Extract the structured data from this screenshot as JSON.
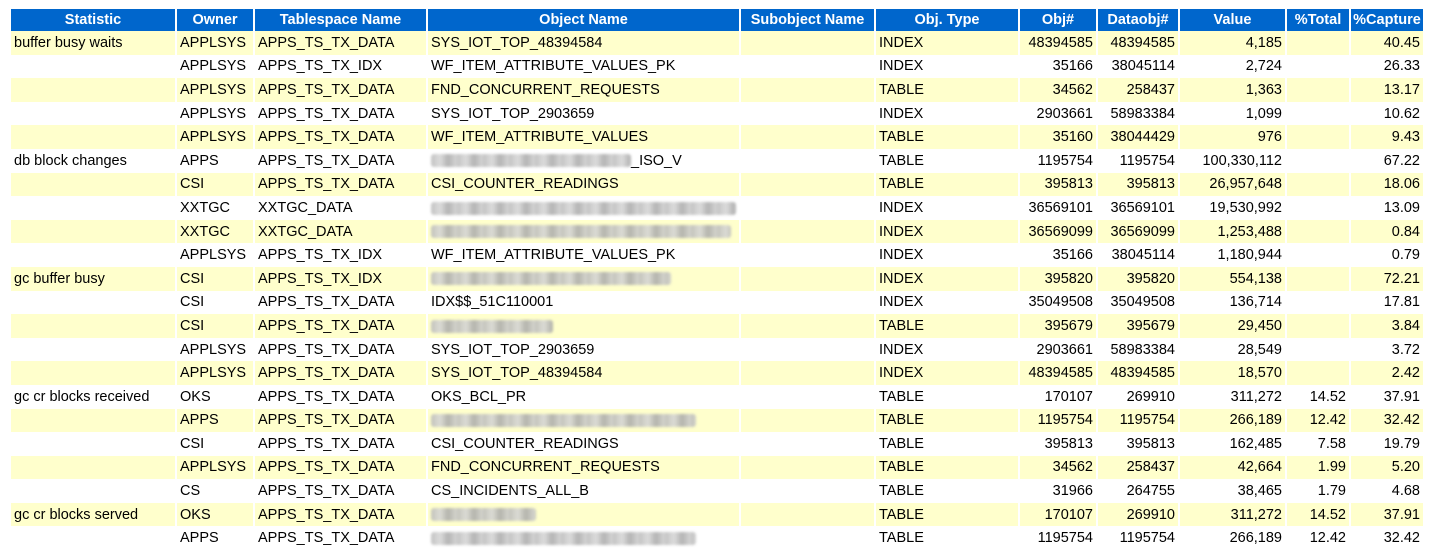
{
  "columns": [
    "Statistic",
    "Owner",
    "Tablespace Name",
    "Object Name",
    "Subobject Name",
    "Obj. Type",
    "Obj#",
    "Dataobj#",
    "Value",
    "%Total",
    "%Capture"
  ],
  "rows": [
    {
      "statistic": "buffer busy waits",
      "owner": "APPLSYS",
      "tablespace": "APPS_TS_TX_DATA",
      "object_name": "SYS_IOT_TOP_48394584",
      "object_redacted": false,
      "subobject": "",
      "obj_type": "INDEX",
      "obj_num": "48394585",
      "dataobj_num": "48394585",
      "value": "4,185",
      "pct_total": "",
      "pct_capture": "40.45"
    },
    {
      "statistic": "",
      "owner": "APPLSYS",
      "tablespace": "APPS_TS_TX_IDX",
      "object_name": "WF_ITEM_ATTRIBUTE_VALUES_PK",
      "object_redacted": false,
      "subobject": "",
      "obj_type": "INDEX",
      "obj_num": "35166",
      "dataobj_num": "38045114",
      "value": "2,724",
      "pct_total": "",
      "pct_capture": "26.33"
    },
    {
      "statistic": "",
      "owner": "APPLSYS",
      "tablespace": "APPS_TS_TX_DATA",
      "object_name": "FND_CONCURRENT_REQUESTS",
      "object_redacted": false,
      "subobject": "",
      "obj_type": "TABLE",
      "obj_num": "34562",
      "dataobj_num": "258437",
      "value": "1,363",
      "pct_total": "",
      "pct_capture": "13.17"
    },
    {
      "statistic": "",
      "owner": "APPLSYS",
      "tablespace": "APPS_TS_TX_DATA",
      "object_name": "SYS_IOT_TOP_2903659",
      "object_redacted": false,
      "subobject": "",
      "obj_type": "INDEX",
      "obj_num": "2903661",
      "dataobj_num": "58983384",
      "value": "1,099",
      "pct_total": "",
      "pct_capture": "10.62"
    },
    {
      "statistic": "",
      "owner": "APPLSYS",
      "tablespace": "APPS_TS_TX_DATA",
      "object_name": "WF_ITEM_ATTRIBUTE_VALUES",
      "object_redacted": false,
      "subobject": "",
      "obj_type": "TABLE",
      "obj_num": "35160",
      "dataobj_num": "38044429",
      "value": "976",
      "pct_total": "",
      "pct_capture": "9.43"
    },
    {
      "statistic": "db block changes",
      "owner": "APPS",
      "tablespace": "APPS_TS_TX_DATA",
      "object_name": "_ISO_V",
      "object_redacted": true,
      "redact_width": 200,
      "subobject": "",
      "obj_type": "TABLE",
      "obj_num": "1195754",
      "dataobj_num": "1195754",
      "value": "100,330,112",
      "pct_total": "",
      "pct_capture": "67.22"
    },
    {
      "statistic": "",
      "owner": "CSI",
      "tablespace": "APPS_TS_TX_DATA",
      "object_name": "CSI_COUNTER_READINGS",
      "object_redacted": false,
      "subobject": "",
      "obj_type": "TABLE",
      "obj_num": "395813",
      "dataobj_num": "395813",
      "value": "26,957,648",
      "pct_total": "",
      "pct_capture": "18.06"
    },
    {
      "statistic": "",
      "owner": "XXTGC",
      "tablespace": "XXTGC_DATA",
      "object_name": "",
      "object_redacted": true,
      "redact_width": 305,
      "subobject": "",
      "obj_type": "INDEX",
      "obj_num": "36569101",
      "dataobj_num": "36569101",
      "value": "19,530,992",
      "pct_total": "",
      "pct_capture": "13.09"
    },
    {
      "statistic": "",
      "owner": "XXTGC",
      "tablespace": "XXTGC_DATA",
      "object_name": "",
      "object_redacted": true,
      "redact_width": 300,
      "subobject": "",
      "obj_type": "INDEX",
      "obj_num": "36569099",
      "dataobj_num": "36569099",
      "value": "1,253,488",
      "pct_total": "",
      "pct_capture": "0.84"
    },
    {
      "statistic": "",
      "owner": "APPLSYS",
      "tablespace": "APPS_TS_TX_IDX",
      "object_name": "WF_ITEM_ATTRIBUTE_VALUES_PK",
      "object_redacted": false,
      "subobject": "",
      "obj_type": "INDEX",
      "obj_num": "35166",
      "dataobj_num": "38045114",
      "value": "1,180,944",
      "pct_total": "",
      "pct_capture": "0.79"
    },
    {
      "statistic": "gc buffer busy",
      "owner": "CSI",
      "tablespace": "APPS_TS_TX_IDX",
      "object_name": "",
      "object_redacted": true,
      "redact_width": 240,
      "subobject": "",
      "obj_type": "INDEX",
      "obj_num": "395820",
      "dataobj_num": "395820",
      "value": "554,138",
      "pct_total": "",
      "pct_capture": "72.21"
    },
    {
      "statistic": "",
      "owner": "CSI",
      "tablespace": "APPS_TS_TX_DATA",
      "object_name": "IDX$$_51C110001",
      "object_redacted": false,
      "subobject": "",
      "obj_type": "INDEX",
      "obj_num": "35049508",
      "dataobj_num": "35049508",
      "value": "136,714",
      "pct_total": "",
      "pct_capture": "17.81"
    },
    {
      "statistic": "",
      "owner": "CSI",
      "tablespace": "APPS_TS_TX_DATA",
      "object_name": "",
      "object_redacted": true,
      "redact_width": 122,
      "subobject": "",
      "obj_type": "TABLE",
      "obj_num": "395679",
      "dataobj_num": "395679",
      "value": "29,450",
      "pct_total": "",
      "pct_capture": "3.84"
    },
    {
      "statistic": "",
      "owner": "APPLSYS",
      "tablespace": "APPS_TS_TX_DATA",
      "object_name": "SYS_IOT_TOP_2903659",
      "object_redacted": false,
      "subobject": "",
      "obj_type": "INDEX",
      "obj_num": "2903661",
      "dataobj_num": "58983384",
      "value": "28,549",
      "pct_total": "",
      "pct_capture": "3.72"
    },
    {
      "statistic": "",
      "owner": "APPLSYS",
      "tablespace": "APPS_TS_TX_DATA",
      "object_name": "SYS_IOT_TOP_48394584",
      "object_redacted": false,
      "subobject": "",
      "obj_type": "INDEX",
      "obj_num": "48394585",
      "dataobj_num": "48394585",
      "value": "18,570",
      "pct_total": "",
      "pct_capture": "2.42"
    },
    {
      "statistic": "gc cr blocks received",
      "owner": "OKS",
      "tablespace": "APPS_TS_TX_DATA",
      "object_name": "OKS_BCL_PR",
      "object_redacted": false,
      "subobject": "",
      "obj_type": "TABLE",
      "obj_num": "170107",
      "dataobj_num": "269910",
      "value": "311,272",
      "pct_total": "14.52",
      "pct_capture": "37.91"
    },
    {
      "statistic": "",
      "owner": "APPS",
      "tablespace": "APPS_TS_TX_DATA",
      "object_name": "",
      "object_redacted": true,
      "redact_width": 265,
      "subobject": "",
      "obj_type": "TABLE",
      "obj_num": "1195754",
      "dataobj_num": "1195754",
      "value": "266,189",
      "pct_total": "12.42",
      "pct_capture": "32.42"
    },
    {
      "statistic": "",
      "owner": "CSI",
      "tablespace": "APPS_TS_TX_DATA",
      "object_name": "CSI_COUNTER_READINGS",
      "object_redacted": false,
      "subobject": "",
      "obj_type": "TABLE",
      "obj_num": "395813",
      "dataobj_num": "395813",
      "value": "162,485",
      "pct_total": "7.58",
      "pct_capture": "19.79"
    },
    {
      "statistic": "",
      "owner": "APPLSYS",
      "tablespace": "APPS_TS_TX_DATA",
      "object_name": "FND_CONCURRENT_REQUESTS",
      "object_redacted": false,
      "subobject": "",
      "obj_type": "TABLE",
      "obj_num": "34562",
      "dataobj_num": "258437",
      "value": "42,664",
      "pct_total": "1.99",
      "pct_capture": "5.20"
    },
    {
      "statistic": "",
      "owner": "CS",
      "tablespace": "APPS_TS_TX_DATA",
      "object_name": "CS_INCIDENTS_ALL_B",
      "object_redacted": false,
      "subobject": "",
      "obj_type": "TABLE",
      "obj_num": "31966",
      "dataobj_num": "264755",
      "value": "38,465",
      "pct_total": "1.79",
      "pct_capture": "4.68"
    },
    {
      "statistic": "gc cr blocks served",
      "owner": "OKS",
      "tablespace": "APPS_TS_TX_DATA",
      "object_name": "",
      "object_redacted": true,
      "redact_width": 105,
      "subobject": "",
      "obj_type": "TABLE",
      "obj_num": "170107",
      "dataobj_num": "269910",
      "value": "311,272",
      "pct_total": "14.52",
      "pct_capture": "37.91"
    },
    {
      "statistic": "",
      "owner": "APPS",
      "tablespace": "APPS_TS_TX_DATA",
      "object_name": "",
      "object_redacted": true,
      "redact_width": 265,
      "subobject": "",
      "obj_type": "TABLE",
      "obj_num": "1195754",
      "dataobj_num": "1195754",
      "value": "266,189",
      "pct_total": "12.42",
      "pct_capture": "32.42"
    }
  ]
}
